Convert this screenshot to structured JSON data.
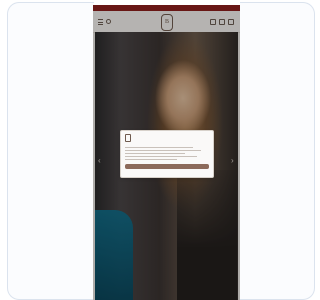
{
  "colors": {
    "brand": "#8b1f1c",
    "accent": "#8c6a5b",
    "modal_bg": "#faf9f8"
  },
  "topbar": {
    "text": ""
  },
  "header": {
    "logo_text": "B",
    "icons": [
      "menu-icon",
      "search-icon",
      "account-icon",
      "wishlist-icon",
      "bag-icon"
    ]
  },
  "hero": {
    "left_arrow": "‹",
    "right_arrow": "›"
  },
  "cookie_modal": {
    "title": "",
    "body": "",
    "accept_label": "",
    "settings_label": ""
  }
}
